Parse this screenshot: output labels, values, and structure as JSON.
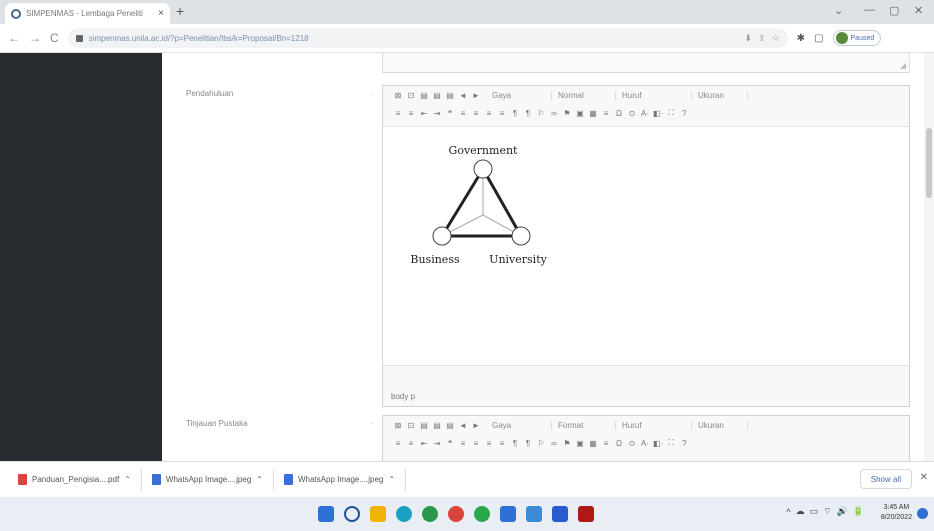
{
  "browser": {
    "tab_title": "SIMPENMAS - Lembaga Peneliti",
    "tab_close": "×",
    "new_tab": "+",
    "url": "simpenmas.unila.ac.id/?p=Penelitian/Ibs/k=Proposal/Bn=1218",
    "profile_label": "Paused",
    "window_controls": [
      "⌄",
      "—",
      "▢",
      "✕"
    ],
    "nav": [
      "←",
      "→",
      "C"
    ],
    "toolbar_icons": [
      "⬇",
      "⇪",
      "☆",
      "✱",
      "▢"
    ]
  },
  "fields": [
    {
      "label": "Pendahuluan",
      "dot": "·",
      "toolbar_row1": [
        "⊠",
        "⊡",
        "▤",
        "▤",
        "▤",
        "◄",
        "►"
      ],
      "combos": [
        "Gaya",
        "Normal",
        "Huruf",
        "Ukuran"
      ],
      "toolbar_row2": [
        "≡",
        "≡",
        "⇤",
        "⇥",
        "❝",
        "≡",
        "≡",
        "≡",
        "≡",
        "¶",
        "¶",
        "⚐",
        "∞",
        "⚑",
        "▣",
        "▦",
        "≡",
        "Ω",
        "⊙",
        "A·",
        "◧·",
        "⛶",
        "?"
      ],
      "footer": "body p"
    },
    {
      "label": "Tinjauan Pustaka",
      "dot": "·",
      "toolbar_row1": [
        "⊠",
        "⊡",
        "▤",
        "▤",
        "▤",
        "◄",
        "►"
      ],
      "combos": [
        "Gaya",
        "Format",
        "Huruf",
        "Ukuran"
      ],
      "toolbar_row2": [
        "≡",
        "≡",
        "⇤",
        "⇥",
        "❝",
        "≡",
        "≡",
        "≡",
        "≡",
        "¶",
        "¶",
        "⚐",
        "∞",
        "⚑",
        "▣",
        "▦",
        "≡",
        "Ω",
        "⊙",
        "A·",
        "◧·",
        "⛶",
        "?"
      ]
    }
  ],
  "diagram": {
    "top": "Government",
    "left": "Business",
    "right": "University"
  },
  "downloads": {
    "items": [
      {
        "name": "Panduan_Pengisia....pdf",
        "color": "#d9453a"
      },
      {
        "name": "WhatsApp Image....jpeg",
        "color": "#3a6fd6"
      },
      {
        "name": "WhatsApp Image....jpeg",
        "color": "#3a6fd6"
      }
    ],
    "caret": "⌃",
    "show_all": "Show all",
    "close": "✕"
  },
  "taskbar": {
    "apps": [
      {
        "name": "start",
        "color": "#2f6fd6"
      },
      {
        "name": "search",
        "color": "#1f4f9a"
      },
      {
        "name": "file-explorer",
        "color": "#f0b400"
      },
      {
        "name": "edge",
        "color": "#1aa0c0"
      },
      {
        "name": "spotify",
        "color": "#2a9a4a"
      },
      {
        "name": "chrome",
        "color": "#d9453a"
      },
      {
        "name": "chrome-2",
        "color": "#2aa84a"
      },
      {
        "name": "mail",
        "color": "#2f6fd6"
      },
      {
        "name": "settings",
        "color": "#3a8ad6"
      },
      {
        "name": "app",
        "color": "#2a5ad0"
      },
      {
        "name": "pdf",
        "color": "#b01818"
      }
    ],
    "tray": [
      "^",
      "☁",
      "▭",
      "⌔",
      "🔊",
      "🔋"
    ],
    "time": "3:45 AM",
    "date": "8/20/2022"
  }
}
